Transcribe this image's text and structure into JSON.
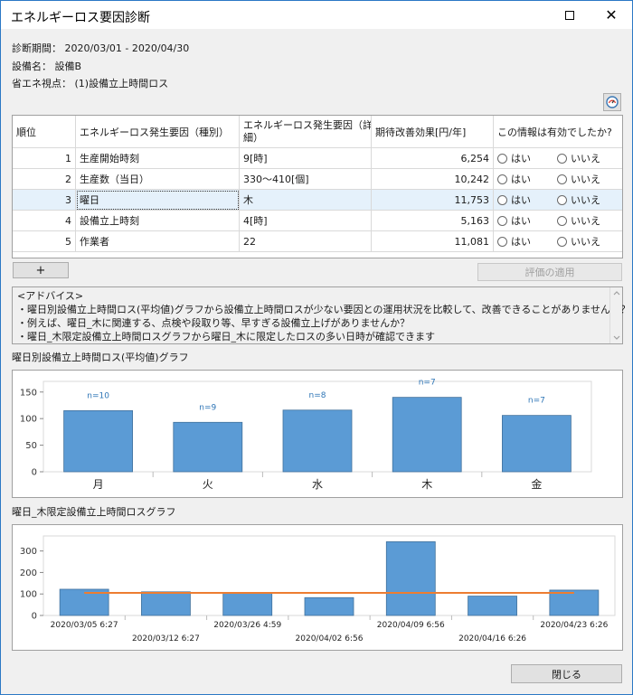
{
  "window": {
    "title": "エネルギーロス要因診断"
  },
  "info": {
    "period_label": "診断期間：",
    "period_value": "2020/03/01 - 2020/04/30",
    "equipment_label": "設備名：",
    "equipment_value": "設備B",
    "viewpoint_label": "省エネ視点：",
    "viewpoint_value": "(1)設備立上時間ロス"
  },
  "table": {
    "headers": [
      "順位",
      "エネルギーロス発生要因（種別）",
      "エネルギーロス発生要因（詳細）",
      "期待改善効果[円/年]",
      "この情報は有効でしたか?"
    ],
    "header_detail_line1": "エネルギーロス発生要因（詳",
    "header_detail_line2": "細）",
    "yes_label": "はい",
    "no_label": "いいえ",
    "rows": [
      {
        "rank": "1",
        "type": "生産開始時刻",
        "detail": "9[時]",
        "effect": "6,254"
      },
      {
        "rank": "2",
        "type": "生産数（当日）",
        "detail": "330～410[個]",
        "effect": "10,242"
      },
      {
        "rank": "3",
        "type": "曜日",
        "detail": "木",
        "effect": "11,753",
        "selected": true
      },
      {
        "rank": "4",
        "type": "設備立上時刻",
        "detail": "4[時]",
        "effect": "5,163"
      },
      {
        "rank": "5",
        "type": "作業者",
        "detail": "22",
        "effect": "11,081"
      }
    ]
  },
  "buttons": {
    "add": "+",
    "apply": "評価の適用",
    "close": "閉じる"
  },
  "advice": {
    "lines": [
      "<アドバイス>",
      "・曜日別設備立上時間ロス(平均値)グラフから設備立上時間ロスが少ない要因との運用状況を比較して、改善できることがありませんか？",
      "・例えば、曜日_木に関連する、点検や段取り等、早すぎる設備立上げがありませんか？",
      "・曜日_木限定設備立上時間ロスグラフから曜日_木に限定したロスの多い日時が確認できます"
    ]
  },
  "chart1_title": "曜日別設備立上時間ロス(平均値)グラフ",
  "chart2_title": "曜日_木限定設備立上時間ロスグラフ",
  "chart_data": [
    {
      "type": "bar",
      "categories": [
        "月",
        "火",
        "水",
        "木",
        "金"
      ],
      "values": [
        115,
        93,
        116,
        140,
        106
      ],
      "annotations": [
        "n=10",
        "n=9",
        "n=8",
        "n=7",
        "n=7"
      ],
      "ylim": [
        0,
        170
      ],
      "yticks": [
        0,
        50,
        100,
        150
      ],
      "color": "#5b9bd5"
    },
    {
      "type": "bar",
      "categories": [
        "2020/03/05 6:27",
        "2020/03/12 6:27",
        "2020/03/26 4:59",
        "2020/04/02 6:56",
        "2020/04/09 6:56",
        "2020/04/16 6:26",
        "2020/04/23 6:26"
      ],
      "values": [
        122,
        110,
        105,
        83,
        343,
        90,
        118
      ],
      "average_line": 105,
      "ylim": [
        0,
        370
      ],
      "yticks": [
        0,
        100,
        200,
        300
      ],
      "color": "#5b9bd5",
      "line_color": "#ed7d31"
    }
  ]
}
